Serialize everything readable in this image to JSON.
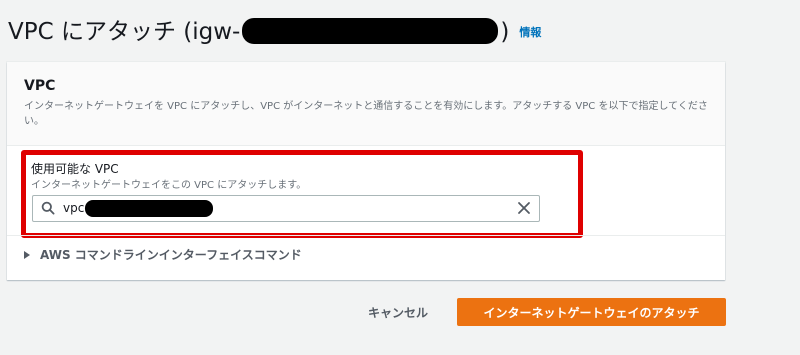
{
  "header": {
    "title_prefix": "VPC にアタッチ (igw-",
    "title_suffix": ")",
    "info_link": "情報"
  },
  "panel": {
    "title": "VPC",
    "description": "インターネットゲートウェイを VPC にアタッチし、VPC がインターネットと通信することを有効にします。アタッチする VPC を以下で指定してください。"
  },
  "vpc_field": {
    "label": "使用可能な VPC",
    "description": "インターネットゲートウェイをこの VPC にアタッチします。",
    "value_prefix": "vpc-"
  },
  "cli": {
    "label": "AWS コマンドラインインターフェイスコマンド"
  },
  "actions": {
    "cancel_label": "キャンセル",
    "attach_label": "インターネットゲートウェイのアタッチ"
  },
  "colors": {
    "primary": "#ec7211",
    "link": "#0073bb",
    "highlight": "#df0000"
  },
  "icons": {
    "search": "search-icon",
    "clear": "close-icon",
    "expand": "caret-right-icon"
  }
}
